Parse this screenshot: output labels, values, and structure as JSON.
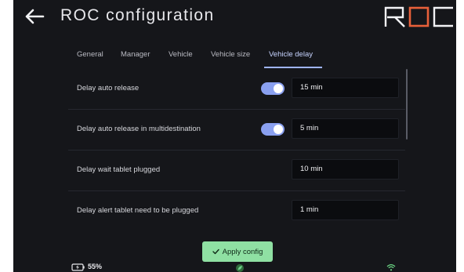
{
  "header": {
    "title": "ROC configuration",
    "logo_text": "ROC",
    "back_icon": "arrow-left-icon"
  },
  "tabs": [
    {
      "label": "General",
      "active": false
    },
    {
      "label": "Manager",
      "active": false
    },
    {
      "label": "Vehicle",
      "active": false
    },
    {
      "label": "Vehicle size",
      "active": false
    },
    {
      "label": "Vehicle delay",
      "active": true
    }
  ],
  "settings": [
    {
      "label": "Delay auto release",
      "toggle": true,
      "toggle_on": true,
      "value": "15 min"
    },
    {
      "label": "Delay auto release in multidestination",
      "toggle": true,
      "toggle_on": true,
      "value": "5 min"
    },
    {
      "label": "Delay wait tablet plugged",
      "toggle": false,
      "value": "10 min"
    },
    {
      "label": "Delay alert tablet need to be plugged",
      "toggle": false,
      "value": "1 min"
    }
  ],
  "apply": {
    "label": "Apply config",
    "icon": "check-icon"
  },
  "status": {
    "battery": "55%",
    "battery_icon": "battery-charging-icon",
    "center_icon": "leaf-icon",
    "wifi_icon": "wifi-icon"
  },
  "colors": {
    "background": "#15161a",
    "accent": "#9fb4ff",
    "toggle_on": "#8aa0f0",
    "apply_button": "#8fe0a3",
    "logo_accent": "#e8603a"
  }
}
